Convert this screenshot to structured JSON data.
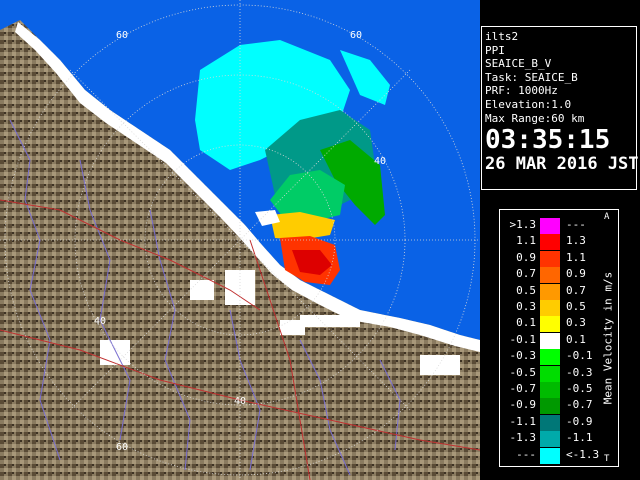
{
  "radar": {
    "ring_labels": [
      "60",
      "40",
      "40",
      "40",
      "40",
      "60",
      "60"
    ]
  },
  "info": {
    "radar_name": "ilts2",
    "scan_type": "PPI",
    "product": "SEAICE_B_V",
    "task": "Task: SEAICE_B",
    "prf": "PRF: 1000Hz",
    "elevation": "Elevation:1.0",
    "max_range": "Max Range:60 km",
    "time": "03:35:15",
    "date": "26 MAR 2016 JST"
  },
  "legend": {
    "unit_label": "Mean Velocity in m/s",
    "corner_mark_top": "A",
    "corner_mark_bottom": "T",
    "rows": [
      {
        "lo": ">1.3",
        "hi": "---",
        "color": "#ff00ff"
      },
      {
        "lo": "1.1",
        "hi": "1.3",
        "color": "#ff0000"
      },
      {
        "lo": "0.9",
        "hi": "1.1",
        "color": "#ff3300"
      },
      {
        "lo": "0.7",
        "hi": "0.9",
        "color": "#ff6600"
      },
      {
        "lo": "0.5",
        "hi": "0.7",
        "color": "#ff9900"
      },
      {
        "lo": "0.3",
        "hi": "0.5",
        "color": "#ffcc00"
      },
      {
        "lo": "0.1",
        "hi": "0.3",
        "color": "#ffff00"
      },
      {
        "lo": "-0.1",
        "hi": "0.1",
        "color": "#ffffff"
      },
      {
        "lo": "-0.3",
        "hi": "-0.1",
        "color": "#00ff00"
      },
      {
        "lo": "-0.5",
        "hi": "-0.3",
        "color": "#00dd00"
      },
      {
        "lo": "-0.7",
        "hi": "-0.5",
        "color": "#00bb00"
      },
      {
        "lo": "-0.9",
        "hi": "-0.7",
        "color": "#009900"
      },
      {
        "lo": "-1.1",
        "hi": "-0.9",
        "color": "#007777"
      },
      {
        "lo": "-1.3",
        "hi": "-1.1",
        "color": "#00aaaa"
      },
      {
        "lo": "---",
        "hi": "<-1.3",
        "color": "#00ffff"
      }
    ]
  },
  "colors": {
    "sea": "#0a62e6",
    "land": "#8a7b60",
    "coast_snow": "#ffffff"
  }
}
